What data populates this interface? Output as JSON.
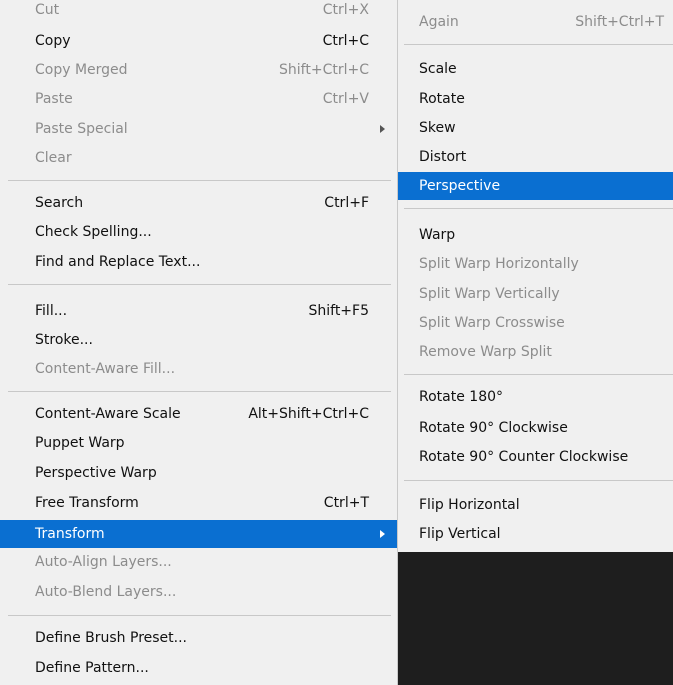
{
  "main_menu": {
    "items": [
      {
        "label": "Cut",
        "shortcut": "Ctrl+X",
        "disabled": true
      },
      {
        "label": "Copy",
        "shortcut": "Ctrl+C",
        "disabled": false
      },
      {
        "label": "Copy Merged",
        "shortcut": "Shift+Ctrl+C",
        "disabled": true
      },
      {
        "label": "Paste",
        "shortcut": "Ctrl+V",
        "disabled": true
      },
      {
        "label": "Paste Special",
        "shortcut": "",
        "disabled": true
      },
      {
        "label": "Clear",
        "shortcut": "",
        "disabled": true
      },
      {
        "label": "Search",
        "shortcut": "Ctrl+F",
        "disabled": false
      },
      {
        "label": "Check Spelling...",
        "shortcut": "",
        "disabled": false
      },
      {
        "label": "Find and Replace Text...",
        "shortcut": "",
        "disabled": false
      },
      {
        "label": "Fill...",
        "shortcut": "Shift+F5",
        "disabled": false
      },
      {
        "label": "Stroke...",
        "shortcut": "",
        "disabled": false
      },
      {
        "label": "Content-Aware Fill...",
        "shortcut": "",
        "disabled": true
      },
      {
        "label": "Content-Aware Scale",
        "shortcut": "Alt+Shift+Ctrl+C",
        "disabled": false
      },
      {
        "label": "Puppet Warp",
        "shortcut": "",
        "disabled": false
      },
      {
        "label": "Perspective Warp",
        "shortcut": "",
        "disabled": false
      },
      {
        "label": "Free Transform",
        "shortcut": "Ctrl+T",
        "disabled": false
      },
      {
        "label": "Transform",
        "shortcut": "",
        "disabled": false
      },
      {
        "label": "Auto-Align Layers...",
        "shortcut": "",
        "disabled": true
      },
      {
        "label": "Auto-Blend Layers...",
        "shortcut": "",
        "disabled": true
      },
      {
        "label": "Define Brush Preset...",
        "shortcut": "",
        "disabled": false
      },
      {
        "label": "Define Pattern...",
        "shortcut": "",
        "disabled": false
      }
    ],
    "highlighted_item": "Transform"
  },
  "transform_submenu": {
    "items": [
      {
        "label": "Again",
        "shortcut": "Shift+Ctrl+T",
        "disabled": true
      },
      {
        "label": "Scale",
        "shortcut": "",
        "disabled": false
      },
      {
        "label": "Rotate",
        "shortcut": "",
        "disabled": false
      },
      {
        "label": "Skew",
        "shortcut": "",
        "disabled": false
      },
      {
        "label": "Distort",
        "shortcut": "",
        "disabled": false
      },
      {
        "label": "Perspective",
        "shortcut": "",
        "disabled": false
      },
      {
        "label": "Warp",
        "shortcut": "",
        "disabled": false
      },
      {
        "label": "Split Warp Horizontally",
        "shortcut": "",
        "disabled": true
      },
      {
        "label": "Split Warp Vertically",
        "shortcut": "",
        "disabled": true
      },
      {
        "label": "Split Warp Crosswise",
        "shortcut": "",
        "disabled": true
      },
      {
        "label": "Remove Warp Split",
        "shortcut": "",
        "disabled": true
      },
      {
        "label": "Rotate 180°",
        "shortcut": "",
        "disabled": false
      },
      {
        "label": "Rotate 90° Clockwise",
        "shortcut": "",
        "disabled": false
      },
      {
        "label": "Rotate 90° Counter Clockwise",
        "shortcut": "",
        "disabled": false
      },
      {
        "label": "Flip Horizontal",
        "shortcut": "",
        "disabled": false
      },
      {
        "label": "Flip Vertical",
        "shortcut": "",
        "disabled": false
      }
    ],
    "highlighted_item": "Perspective"
  },
  "colors": {
    "menu_background": "#f0f0f0",
    "highlight": "#0a6fd1",
    "disabled_text": "#8c8c8c",
    "canvas_background": "#1e1e1e"
  }
}
